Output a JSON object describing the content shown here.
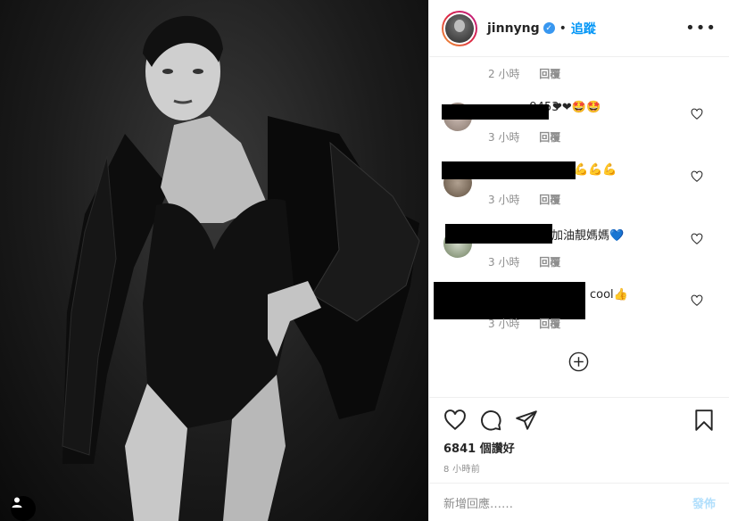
{
  "post": {
    "username": "jinnyng",
    "follow_label": "追蹤",
    "dot": "•",
    "more_label": "•••"
  },
  "comments": {
    "top_meta": {
      "time": "2 小時",
      "reply": "回覆"
    },
    "items": [
      {
        "visible_text": "❤❤🤩🤩",
        "partial_username": "...9453",
        "time": "3 小時",
        "reply": "回覆"
      },
      {
        "visible_text": "💪💪💪",
        "time": "3 小時",
        "reply": "回覆"
      },
      {
        "visible_text": "加油靚媽媽💙",
        "time": "3 小時",
        "reply": "回覆"
      },
      {
        "visible_text": "cool👍",
        "time": "3 小時",
        "reply": "回覆"
      }
    ]
  },
  "actions": {
    "likes": "6841 個讚好",
    "time_ago": "8 小時前"
  },
  "add_comment": {
    "placeholder": "新增回應……",
    "post_label": "發佈"
  },
  "icons": [
    "heart-icon",
    "comment-icon",
    "share-icon",
    "bookmark-icon",
    "add-circle-icon",
    "user-tag-icon",
    "verified-badge-icon"
  ]
}
